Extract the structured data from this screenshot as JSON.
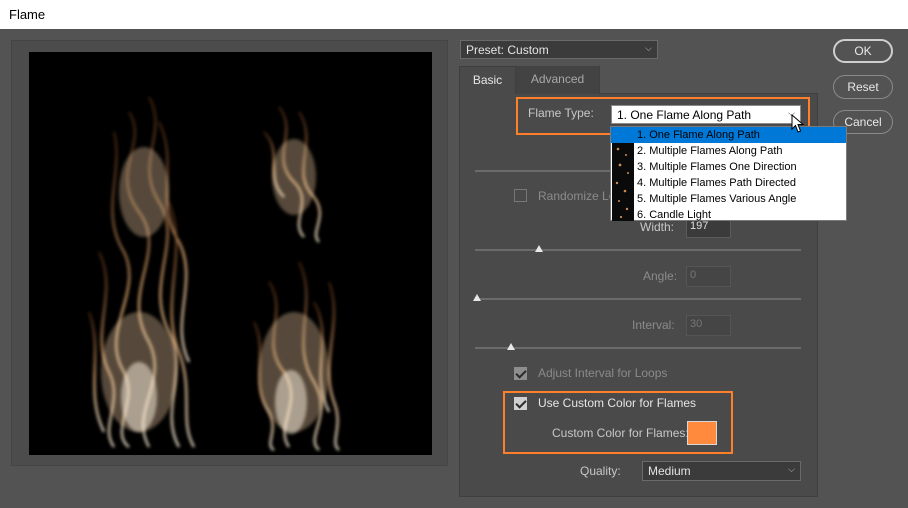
{
  "window": {
    "title": "Flame"
  },
  "preset": {
    "label": "Preset: Custom"
  },
  "buttons": {
    "ok": "OK",
    "reset": "Reset",
    "cancel": "Cancel"
  },
  "tabs": {
    "basic": "Basic",
    "advanced": "Advanced"
  },
  "flame_type": {
    "label": "Flame Type:",
    "value": "1. One Flame Along Path",
    "options": [
      "1. One Flame Along Path",
      "2. Multiple Flames Along Path",
      "3. Multiple Flames One Direction",
      "4. Multiple Flames Path Directed",
      "5. Multiple Flames Various Angle",
      "6. Candle Light"
    ]
  },
  "randomize": {
    "label": "Randomize Len"
  },
  "width": {
    "label": "Width:",
    "value": "197"
  },
  "angle": {
    "label": "Angle:",
    "value": "0"
  },
  "interval": {
    "label": "Interval:",
    "value": "30"
  },
  "adjust_interval": {
    "label": "Adjust Interval for Loops",
    "checked": true
  },
  "custom_color": {
    "label": "Use Custom Color for Flames",
    "checked": true,
    "color_label": "Custom Color for Flames:",
    "color": "#ff8a3d"
  },
  "quality": {
    "label": "Quality:",
    "value": "Medium"
  },
  "colors": {
    "highlight": "#ff7f2a",
    "flame": "#f4c89a"
  }
}
